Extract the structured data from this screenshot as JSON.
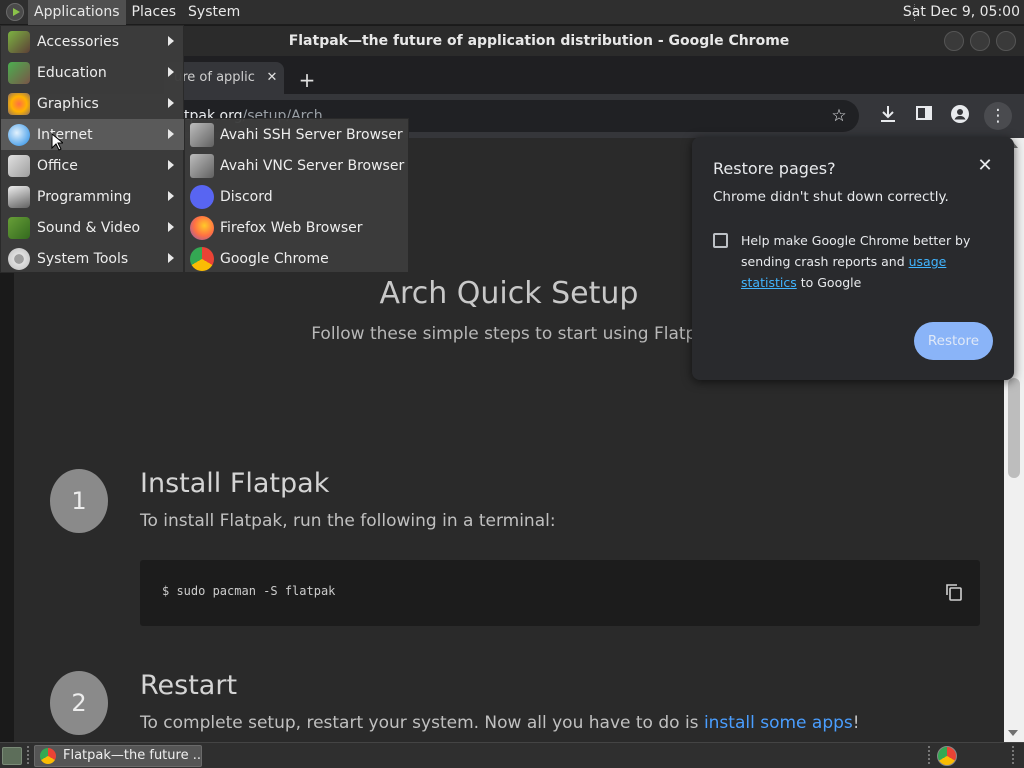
{
  "top_panel": {
    "menus": [
      "Applications",
      "Places",
      "System"
    ],
    "clock": "Sat Dec  9, 05:00"
  },
  "window": {
    "title": "Flatpak—the future of application distribution - Google Chrome",
    "tab_title": "ure of applic",
    "url_host": "tpak.org",
    "url_path": "/setup/Arch"
  },
  "page": {
    "hero_title": "Arch Quick Setup",
    "hero_subtitle": "Follow these simple steps to start using Flatpa",
    "steps": [
      {
        "number": "1",
        "title": "Install Flatpak",
        "description": "To install Flatpak, run the following in a terminal:",
        "code": "$ sudo pacman -S flatpak"
      },
      {
        "number": "2",
        "title": "Restart",
        "description_prefix": "To complete setup, restart your system. Now all you have to do is ",
        "link": "install some apps",
        "description_suffix": "!"
      }
    ]
  },
  "restore_dialog": {
    "title": "Restore pages?",
    "message": "Chrome didn't shut down correctly.",
    "checkbox_text_1": "Help make Google Chrome better by sending crash reports and ",
    "checkbox_link": "usage statistics",
    "checkbox_text_2": " to Google",
    "button": "Restore"
  },
  "applications_menu": {
    "items": [
      {
        "label": "Accessories",
        "icon": "accessories-icon"
      },
      {
        "label": "Education",
        "icon": "education-icon"
      },
      {
        "label": "Graphics",
        "icon": "graphics-icon"
      },
      {
        "label": "Internet",
        "icon": "internet-icon"
      },
      {
        "label": "Office",
        "icon": "office-icon"
      },
      {
        "label": "Programming",
        "icon": "programming-icon"
      },
      {
        "label": "Sound & Video",
        "icon": "sound-video-icon"
      },
      {
        "label": "System Tools",
        "icon": "system-tools-icon"
      }
    ],
    "active": "Internet"
  },
  "internet_submenu": {
    "items": [
      {
        "label": "Avahi SSH Server Browser",
        "icon": "avahi-icon"
      },
      {
        "label": "Avahi VNC Server Browser",
        "icon": "avahi-icon"
      },
      {
        "label": "Discord",
        "icon": "discord-icon"
      },
      {
        "label": "Firefox Web Browser",
        "icon": "firefox-icon"
      },
      {
        "label": "Google Chrome",
        "icon": "chrome-icon"
      }
    ]
  },
  "taskbar": {
    "task_label": "Flatpak—the future ..."
  },
  "colors": {
    "link_blue": "#4a9eff",
    "restore_button": "#8ab4f8",
    "panel_bg": "#2f2f2f"
  }
}
